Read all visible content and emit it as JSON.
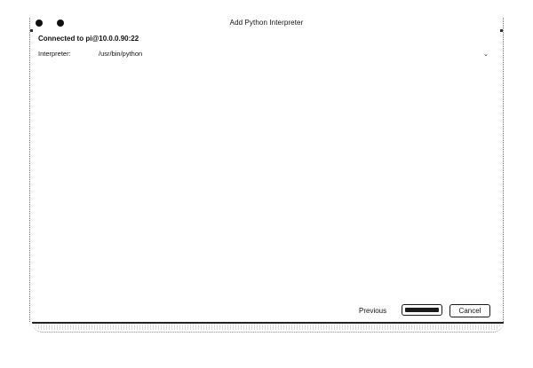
{
  "window": {
    "title": "Add Python Interpreter"
  },
  "connection": {
    "text": "Connected to pi@10.0.0.90:22"
  },
  "interpreter": {
    "label": "Interpreter:",
    "value": "/usr/bin/python",
    "dropdown_icon": "chevron-down-icon"
  },
  "footer": {
    "previous_label": "Previous",
    "cancel_label": "Cancel"
  },
  "colors": {
    "background": "#ffffff",
    "text": "#111111",
    "border": "#1a1a1a"
  }
}
